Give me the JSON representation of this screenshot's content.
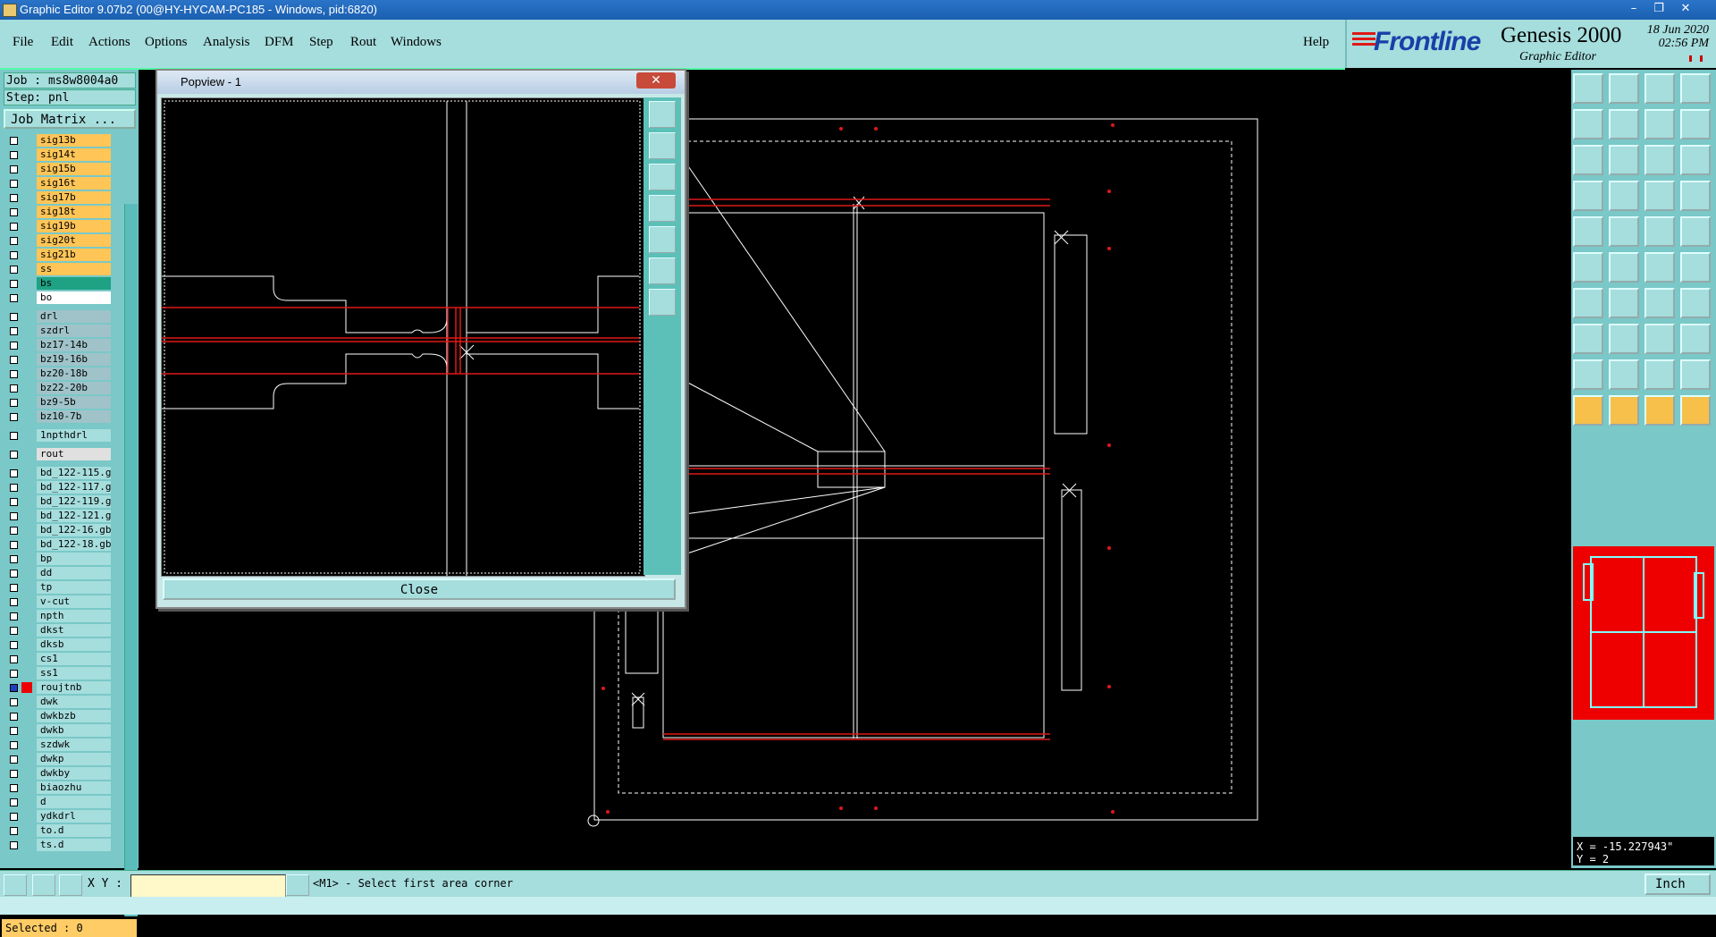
{
  "window": {
    "title": "Graphic Editor 9.07b2 (00@HY-HYCAM-PC185 - Windows, pid:6820)"
  },
  "menu": [
    "File",
    "Edit",
    "Actions",
    "Options",
    "Analysis",
    "DFM",
    "Step",
    "Rout",
    "Windows"
  ],
  "help_label": "Help",
  "brand": {
    "logo": "Frontline",
    "product": "Genesis 2000",
    "subtitle": "Graphic Editor",
    "date": "18 Jun 2020",
    "time": "02:56 PM"
  },
  "job": {
    "job_label": "Job : ms8w8004a0",
    "step_label": "Step: pnl",
    "matrix_button": "Job Matrix ..."
  },
  "layers": [
    {
      "name": "sig13b",
      "color": "#ffc557"
    },
    {
      "name": "sig14t",
      "color": "#ffc557"
    },
    {
      "name": "sig15b",
      "color": "#ffc557"
    },
    {
      "name": "sig16t",
      "color": "#ffc557"
    },
    {
      "name": "sig17b",
      "color": "#ffc557"
    },
    {
      "name": "sig18t",
      "color": "#ffc557"
    },
    {
      "name": "sig19b",
      "color": "#ffc557"
    },
    {
      "name": "sig20t",
      "color": "#ffc557"
    },
    {
      "name": "sig21b",
      "color": "#ffc557"
    },
    {
      "name": "ss",
      "color": "#ffc557"
    },
    {
      "name": "bs",
      "color": "#1ea283"
    },
    {
      "name": "bo",
      "color": "#ffffff"
    },
    {
      "name": "drl",
      "color": "#9fc3c9"
    },
    {
      "name": "szdrl",
      "color": "#9fc3c9"
    },
    {
      "name": "bz17-14b",
      "color": "#9fc3c9"
    },
    {
      "name": "bz19-16b",
      "color": "#9fc3c9"
    },
    {
      "name": "bz20-18b",
      "color": "#9fc3c9"
    },
    {
      "name": "bz22-20b",
      "color": "#9fc3c9"
    },
    {
      "name": "bz9-5b",
      "color": "#9fc3c9"
    },
    {
      "name": "bz10-7b",
      "color": "#9fc3c9"
    },
    {
      "name": "1npthdrl",
      "color": "#a6dddd"
    },
    {
      "name": "rout",
      "color": "#e0e0e0"
    },
    {
      "name": "bd_122-115.g",
      "color": "#a6dddd"
    },
    {
      "name": "bd_122-117.g",
      "color": "#a6dddd"
    },
    {
      "name": "bd_122-119.g",
      "color": "#a6dddd"
    },
    {
      "name": "bd_122-121.g",
      "color": "#a6dddd"
    },
    {
      "name": "bd_122-16.gb",
      "color": "#a6dddd"
    },
    {
      "name": "bd_122-18.gb",
      "color": "#a6dddd"
    },
    {
      "name": "bp",
      "color": "#a6dddd"
    },
    {
      "name": "dd",
      "color": "#a6dddd"
    },
    {
      "name": "tp",
      "color": "#a6dddd"
    },
    {
      "name": "v-cut",
      "color": "#a6dddd"
    },
    {
      "name": "npth",
      "color": "#a6dddd"
    },
    {
      "name": "dkst",
      "color": "#a6dddd"
    },
    {
      "name": "dksb",
      "color": "#a6dddd"
    },
    {
      "name": "cs1",
      "color": "#a6dddd"
    },
    {
      "name": "ss1",
      "color": "#a6dddd"
    },
    {
      "name": "roujtnb",
      "color": "#a6dddd"
    },
    {
      "name": "dwk",
      "color": "#a6dddd"
    },
    {
      "name": "dwkbzb",
      "color": "#a6dddd"
    },
    {
      "name": "dwkb",
      "color": "#a6dddd"
    },
    {
      "name": "szdwk",
      "color": "#a6dddd"
    },
    {
      "name": "dwkp",
      "color": "#a6dddd"
    },
    {
      "name": "dwkby",
      "color": "#a6dddd"
    },
    {
      "name": "biaozhu",
      "color": "#a6dddd"
    },
    {
      "name": "d",
      "color": "#a6dddd"
    },
    {
      "name": "ydkdrl",
      "color": "#a6dddd"
    },
    {
      "name": "to.d",
      "color": "#a6dddd"
    },
    {
      "name": "ts.d",
      "color": "#a6dddd"
    }
  ],
  "selected_label": "Selected : 0",
  "popview": {
    "title": "Popview - 1",
    "close_label": "Close"
  },
  "coords": {
    "x": "X = -15.227943\"",
    "y": "Y = 2"
  },
  "status": {
    "xy_label": "X Y :",
    "xy_value": "",
    "prompt": "<M1> - Select first area corner",
    "units": "Inch"
  },
  "colors": {
    "accent": "#a6dddd",
    "panel": "#7ac8c8",
    "highlight": "#ffc557",
    "rout": "#e01818"
  }
}
